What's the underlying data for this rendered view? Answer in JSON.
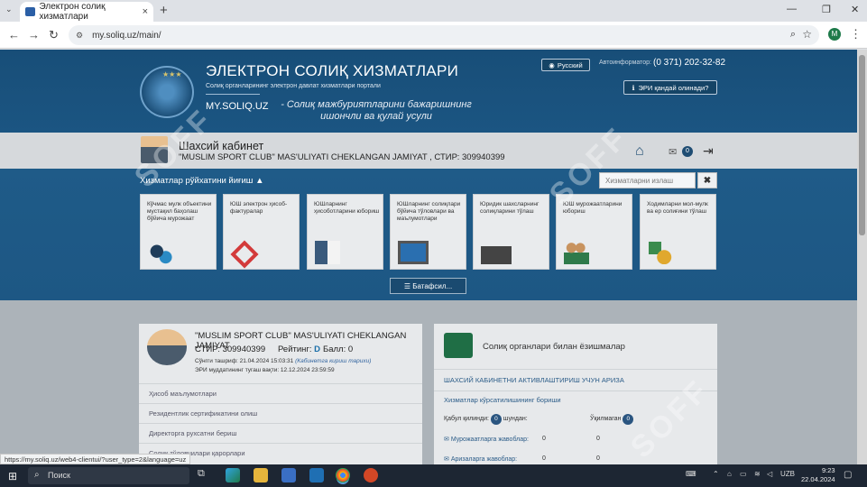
{
  "browser": {
    "tab_title": "Электрон солиқ хизматлари",
    "tab_close": "×",
    "new_tab": "+",
    "url": "my.soliq.uz/main/",
    "status_url": "https://my.soliq.uz/web4-clientui/?user_type=2&language=uz",
    "profile_letter": "M"
  },
  "hero": {
    "title": "ЭЛЕКТРОН СОЛИҚ ХИЗМАТЛАРИ",
    "subtitle": "Солиқ органларининг электрон давлат хизматлари портали",
    "site": "MY.SOLIQ.UZ",
    "slogan": "- Солиқ мажбуриятларини бажаришнинг ишончли ва қулай усули",
    "lang_button": "Русский",
    "autoinfo_label": "Автоинформатор:",
    "phone": "(0 371) 202-32-82",
    "ecp_button": "ЭРИ қандай олинади?"
  },
  "cabinet": {
    "title": "Шахсий кабинет",
    "company": "\"MUSLIM SPORT CLUB\" MAS'ULIYATI CHEKLANGAN JAMIYAT , СТИР: 309940399",
    "mail_count": "0"
  },
  "services": {
    "heading": "Хизматлар рўйхатини йиғиш",
    "search_placeholder": "Хизматларни излаш",
    "clear": "✖",
    "cards": [
      {
        "label": "Кўчмас мулк объектини мустақил баҳолаш бўйича мурожаат"
      },
      {
        "label": "ЮШ электрон ҳисоб-фактуралар"
      },
      {
        "label": "ЮШларнинг ҳисоботларини юбориш"
      },
      {
        "label": "ЮШларнинг солиқлари бўйича тўловлари ва маълумотлари"
      },
      {
        "label": "Юридик шахсларнинг солиқларини тўлаш"
      },
      {
        "label": "ЮШ мурожаатларини юбориш"
      },
      {
        "label": "Ходимларни мол-мулк ва ер солиғини тўлаш"
      }
    ],
    "detail_button": "Батафсил..."
  },
  "profile": {
    "name": "\"MUSLIM SPORT CLUB\" MAS'ULIYATI CHEKLANGAN JAMIYAT",
    "tin": "СТИР: 309940399",
    "rating_label": "Рейтинг:",
    "rating_value": "D",
    "ball": "Балл: 0",
    "last_login": "Сўнгги ташриф: 21.04.2024 15:03:31",
    "last_login_note": "(Кабинетга кириш тарихи)",
    "ecp_expiry": "ЭРИ муддатининг тугаш вақти: 12.12.2024 23:59:59",
    "links": [
      "Ҳисоб маълумотлари",
      "Резидентлик сертификатини олиш",
      "Директорга рухсатни бериш",
      "Солиқ тўловчилари қарорлари"
    ]
  },
  "messages": {
    "title": "Солиқ органлари билан ёзишмалар",
    "link1": "ШАХСИЙ КАБИНЕТНИ АКТИВЛАШТИРИШ УЧУН АРИЗА",
    "link2": "Хизматлар кўрсатилишининг бориши",
    "received_label": "Қабул қилинди:",
    "received_count": "0",
    "from_label": "шундан:",
    "unread_label": "Ўқилмаган",
    "unread_count": "0",
    "rows": [
      {
        "label": "Мурожаатларга жавоблар:",
        "a": "0",
        "b": "0"
      },
      {
        "label": "Аризаларга жавоблар:",
        "a": "0",
        "b": "0"
      }
    ]
  },
  "taskbar": {
    "search": "Поиск",
    "lang": "UZB",
    "time": "9:23",
    "date": "22.04.2024"
  },
  "watermark": "SOFF"
}
